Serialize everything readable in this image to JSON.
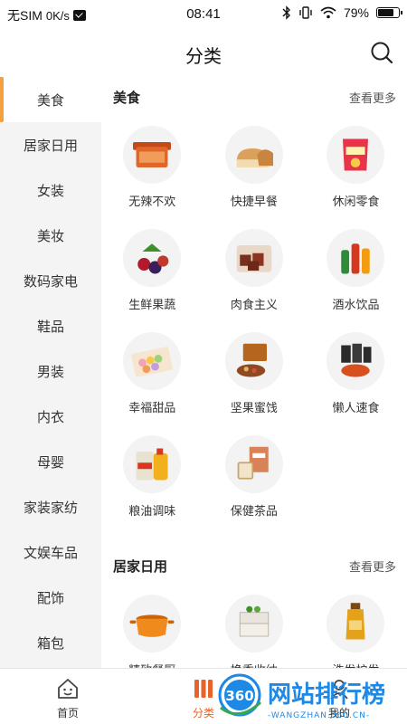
{
  "status_bar": {
    "carrier": "无SIM",
    "speed": "0K/s",
    "time": "08:41",
    "battery": "79%",
    "battery_level": 0.79
  },
  "header": {
    "title": "分类"
  },
  "sidebar": {
    "items": [
      {
        "label": "美食",
        "active": true
      },
      {
        "label": "居家日用"
      },
      {
        "label": "女装"
      },
      {
        "label": "美妆"
      },
      {
        "label": "数码家电"
      },
      {
        "label": "鞋品"
      },
      {
        "label": "男装"
      },
      {
        "label": "内衣"
      },
      {
        "label": "母婴"
      },
      {
        "label": "家装家纺"
      },
      {
        "label": "文娱车品"
      },
      {
        "label": "配饰"
      },
      {
        "label": "箱包"
      }
    ]
  },
  "sections": [
    {
      "title": "美食",
      "more": "查看更多",
      "items": [
        {
          "label": "无辣不欢",
          "icon": "spicy-snacks-icon"
        },
        {
          "label": "快捷早餐",
          "icon": "bread-icon"
        },
        {
          "label": "休闲零食",
          "icon": "chips-bag-icon"
        },
        {
          "label": "生鲜果蔬",
          "icon": "berries-icon"
        },
        {
          "label": "肉食主义",
          "icon": "meat-icon"
        },
        {
          "label": "酒水饮品",
          "icon": "bottles-icon"
        },
        {
          "label": "幸福甜品",
          "icon": "macarons-icon"
        },
        {
          "label": "坚果蜜饯",
          "icon": "nuts-icon"
        },
        {
          "label": "懒人速食",
          "icon": "instant-noodles-icon"
        },
        {
          "label": "粮油调味",
          "icon": "rice-oil-icon"
        },
        {
          "label": "保健茶品",
          "icon": "tea-icon"
        }
      ]
    },
    {
      "title": "居家日用",
      "more": "查看更多",
      "items": [
        {
          "label": "精致餐厨",
          "icon": "pot-icon"
        },
        {
          "label": "换季收纳",
          "icon": "storage-box-icon"
        },
        {
          "label": "洗发护发",
          "icon": "shampoo-icon"
        }
      ]
    }
  ],
  "tab_bar": {
    "tabs": [
      {
        "label": "首页",
        "icon": "home-icon"
      },
      {
        "label": "分类",
        "icon": "category-icon",
        "active": true
      },
      {
        "label": "我的",
        "icon": "profile-icon"
      }
    ]
  },
  "watermark": {
    "brand": "网站排行榜",
    "badge": "360",
    "url": "WANGZHAN.360.CN"
  },
  "colors": {
    "accent": "#e8622a",
    "sidebar_active_bar": "#f4a03c",
    "sidebar_bg": "#f4f4f4",
    "watermark_blue": "#1e88e5"
  }
}
